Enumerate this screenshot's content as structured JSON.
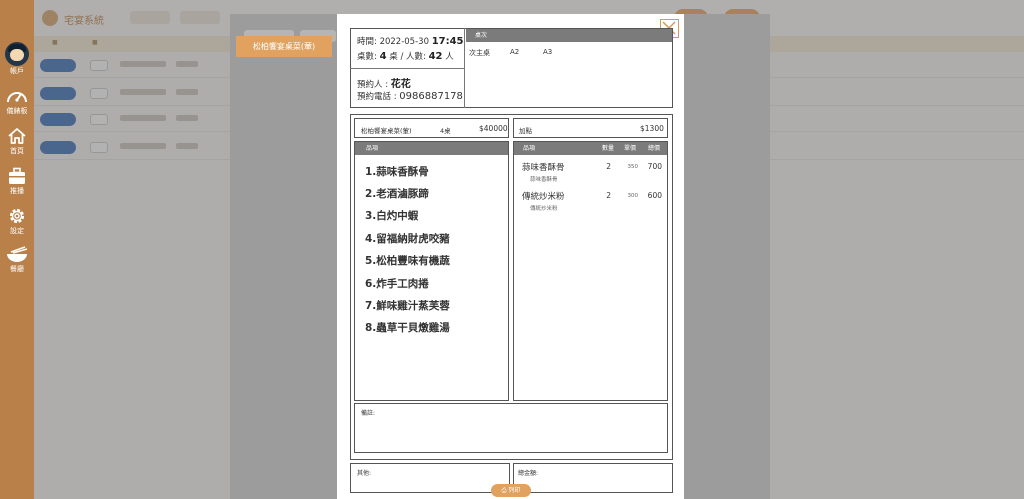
{
  "sidebar": {
    "items": [
      {
        "label": "帳戶",
        "icon": "avatar-icon"
      },
      {
        "label": "儀錶板",
        "icon": "gauge-icon"
      },
      {
        "label": "首頁",
        "icon": "home-icon"
      },
      {
        "label": "推播",
        "icon": "briefcase-icon"
      },
      {
        "label": "設定",
        "icon": "gear-icon"
      },
      {
        "label": "餐廳",
        "icon": "bowl-icon"
      }
    ]
  },
  "underlay": {
    "title": "宅宴系統"
  },
  "tag_button": {
    "label": "松柏饗宴桌菜(葷)"
  },
  "reservation": {
    "time_label": "時間:",
    "date": "2022-05-30",
    "time": "17:45",
    "tables_label": "桌數:",
    "tables": "4",
    "tables_unit": "桌 / 人數:",
    "people": "42",
    "people_unit": "人",
    "booker_label": "預約人 :",
    "booker": "花花",
    "phone_label": "預約電話 :",
    "phone": "0986887178"
  },
  "table_section": {
    "header": "桌次",
    "seats": [
      "次主桌",
      "A2",
      "A3"
    ]
  },
  "set_menu": {
    "name": "松柏饗宴桌菜(葷)",
    "tables": "4桌",
    "price": "$40000",
    "column_header": "品項",
    "dishes": [
      "1.蒜味香酥骨",
      "2.老酒滷豚蹄",
      "3.白灼中蝦",
      "4.留福納財虎咬豬",
      "5.松柏豐味有機蔬",
      "6.炸手工肉捲",
      "7.鮮味雞汁蒸芙蓉",
      "8.蟲草干貝燉雞湯"
    ]
  },
  "addons": {
    "label": "加點",
    "total": "$1300",
    "headers": {
      "item": "品項",
      "qty": "數量",
      "unit": "單價",
      "subtotal": "總價"
    },
    "items": [
      {
        "name": "蒜味香酥骨",
        "sub": "蒜味香酥骨",
        "qty": "2",
        "unit": "350",
        "subtotal": "700"
      },
      {
        "name": "傳統炒米粉",
        "sub": "傳統炒米粉",
        "qty": "2",
        "unit": "300",
        "subtotal": "600"
      }
    ]
  },
  "remarks_label": "備註:",
  "others_label": "其他:",
  "grand_total_label": "總金額:",
  "print_label": "列印",
  "colors": {
    "accent": "#e0a25e",
    "sidebar": "#b9804a",
    "header_gray": "#7b7b7b"
  }
}
